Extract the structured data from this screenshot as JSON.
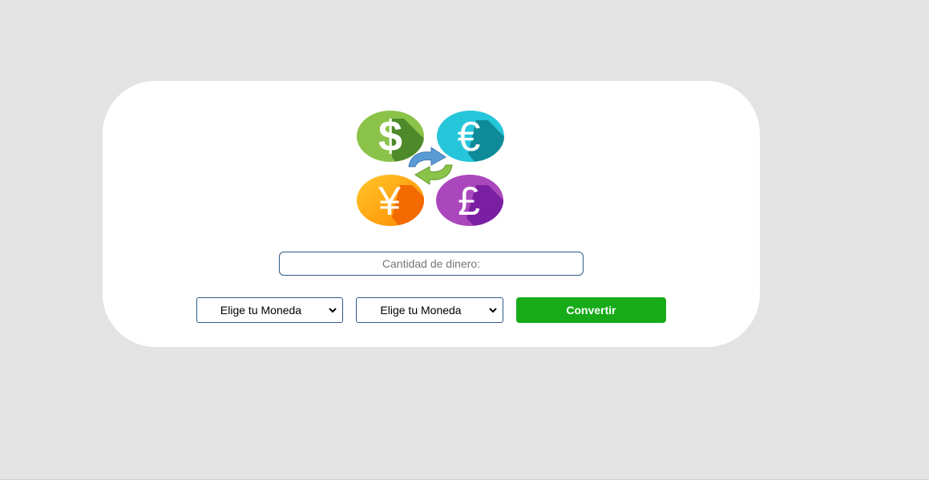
{
  "converter": {
    "amount_placeholder": "Cantidad de dinero:",
    "from_currency_selected": "Elige tu Moneda",
    "to_currency_selected": "Elige tu Moneda",
    "convert_label": "Convertir"
  },
  "logo": {
    "icons": [
      "dollar-icon",
      "euro-icon",
      "yen-icon",
      "pound-icon",
      "exchange-arrows-icon"
    ],
    "colors": {
      "dollar": "#8bc34a",
      "euro": "#26c6da",
      "yen": "#ffb300",
      "pound": "#ab47bc",
      "arrows_top": "#5b9bd5",
      "arrows_bottom": "#8bc34a"
    }
  },
  "colors": {
    "background": "#e3e3e3",
    "card": "#ffffff",
    "accent_button": "#17ab1a",
    "field_border": "#2e5a87"
  }
}
